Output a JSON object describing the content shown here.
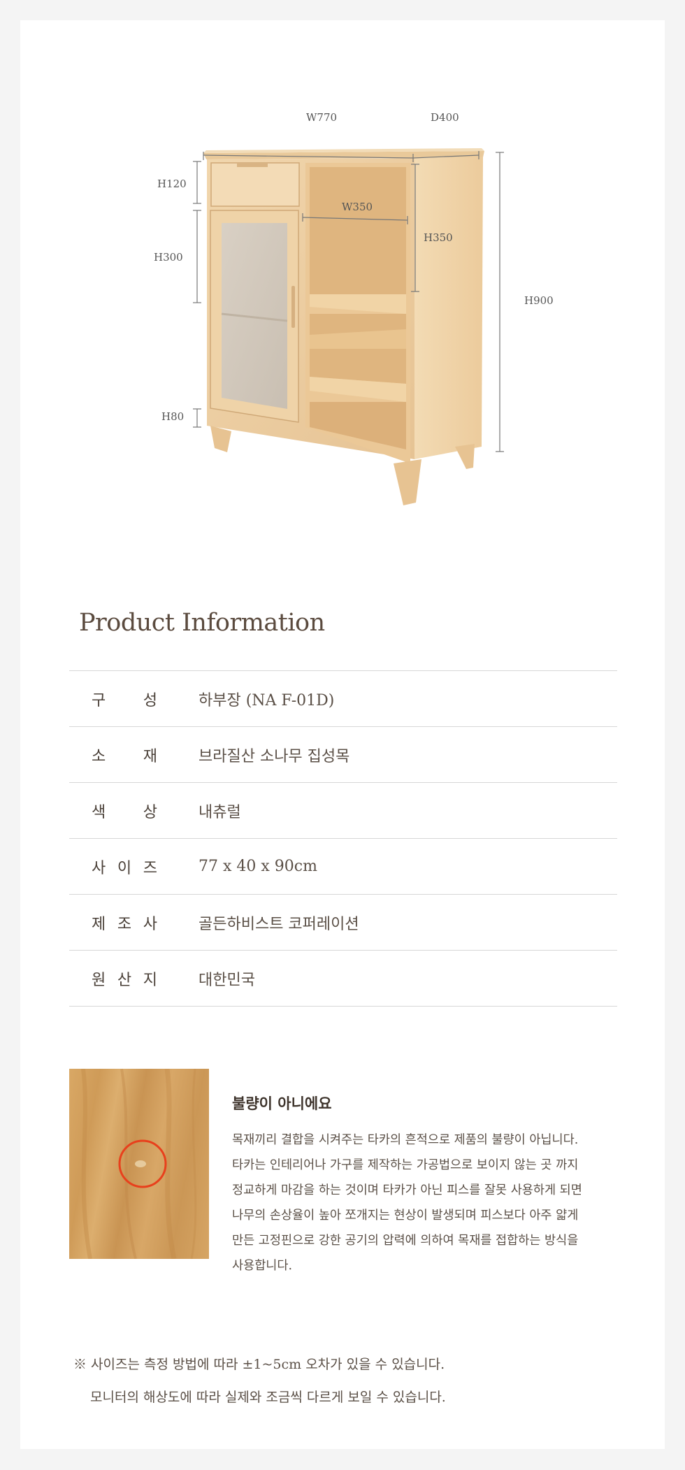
{
  "diagram": {
    "dims": {
      "w770": "W770",
      "d400": "D400",
      "h120": "H120",
      "h300": "H300",
      "w350": "W350",
      "h350": "H350",
      "h900": "H900",
      "h80": "H80"
    }
  },
  "info": {
    "title": "Product Information",
    "rows": [
      {
        "label": [
          "구",
          "성"
        ],
        "value": "하부장 (NA F-01D)"
      },
      {
        "label": [
          "소",
          "재"
        ],
        "value": "브라질산 소나무 집성목"
      },
      {
        "label": [
          "색",
          "상"
        ],
        "value": "내츄럴"
      },
      {
        "label": [
          "사",
          "이",
          "즈"
        ],
        "value": "77 x 40 x 90cm"
      },
      {
        "label": [
          "제",
          "조",
          "사"
        ],
        "value": "골든하비스트 코퍼레이션"
      },
      {
        "label": [
          "원",
          "산",
          "지"
        ],
        "value": "대한민국"
      }
    ]
  },
  "notice": {
    "title": "불량이 아니에요",
    "lines": [
      "목재끼리 결합을 시켜주는 타카의 흔적으로 제품의 불량이 아닙니다.",
      "타카는 인테리어나 가구를 제작하는 가공법으로 보이지 않는 곳 까지",
      "정교하게 마감을 하는 것이며 타카가 아닌 피스를 잘못 사용하게 되면",
      "나무의 손상율이 높아 쪼개지는 현상이 발생되며 피스보다 아주 얇게",
      "만든 고정핀으로 강한 공기의 압력에 의하여 목재를 접합하는 방식을",
      "사용합니다."
    ],
    "highlight_color": "#e8401c"
  },
  "footnote": {
    "line1": "※ 사이즈는 측정 방법에 따라 ±1~5cm 오차가 있을 수 있습니다.",
    "line2": "모니터의 해상도에 따라 실제와 조금씩 다르게 보일 수 있습니다."
  }
}
